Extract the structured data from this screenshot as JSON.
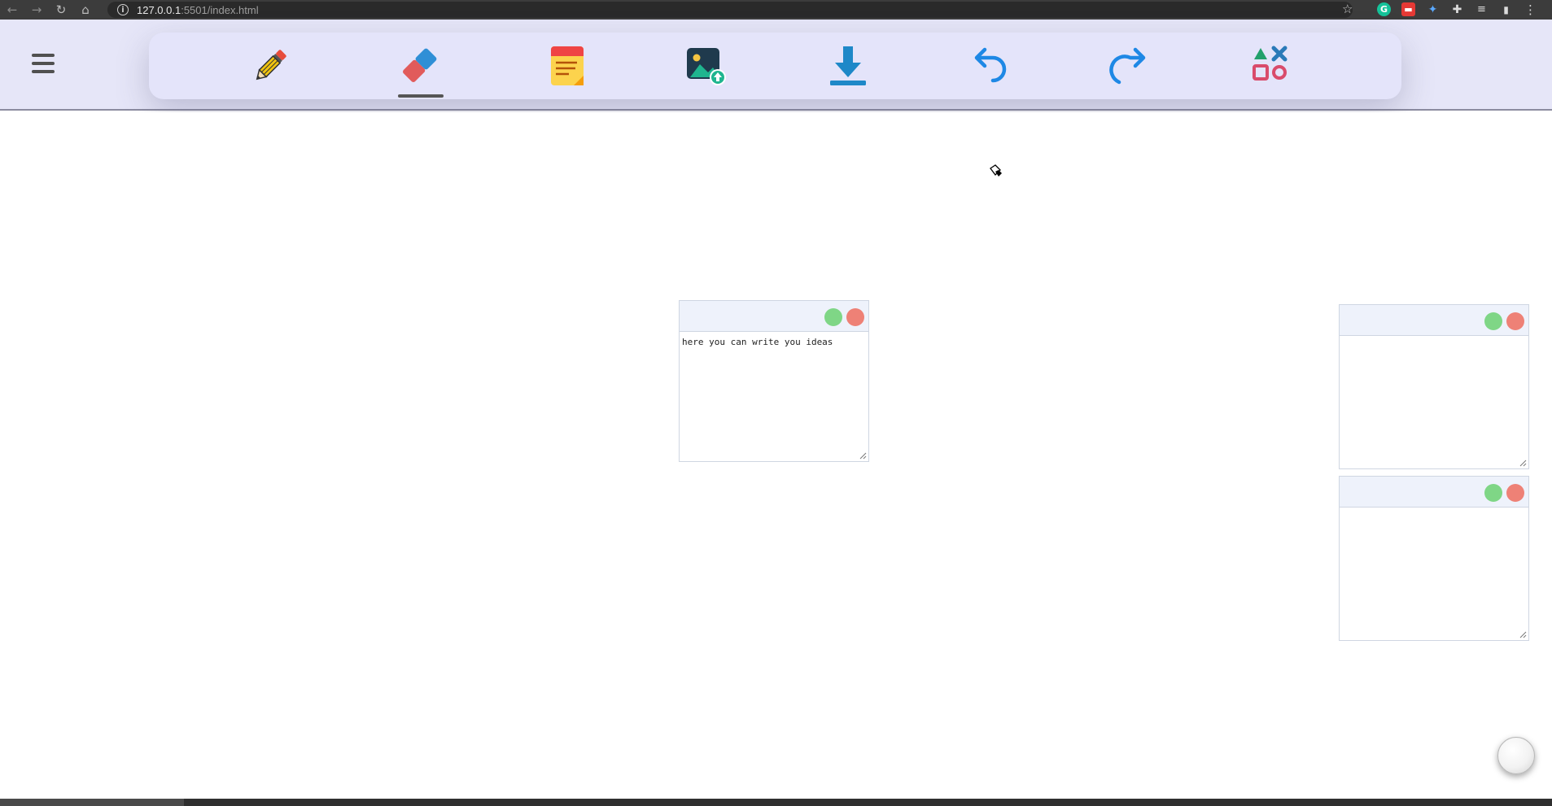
{
  "browser": {
    "url_host": "127.0.0.1",
    "url_rest": ":5501/index.html",
    "icons": [
      "back-arrow-icon",
      "forward-arrow-icon",
      "reload-icon",
      "home-icon",
      "info-icon",
      "star-icon",
      "grammarly-icon",
      "red-extension-icon",
      "blue-extension-icon",
      "puzzle-icon",
      "media-icon",
      "profile-icon",
      "menu-dots-icon"
    ],
    "grammarly_letter": "G"
  },
  "toolbar": {
    "tools": [
      {
        "name": "pencil",
        "icon": "pencil-icon"
      },
      {
        "name": "eraser",
        "icon": "eraser-icon",
        "active": true
      },
      {
        "name": "sticky-note",
        "icon": "sticky-note-icon"
      },
      {
        "name": "upload-image",
        "icon": "image-upload-icon"
      },
      {
        "name": "download",
        "icon": "download-icon"
      },
      {
        "name": "undo",
        "icon": "undo-icon"
      },
      {
        "name": "redo",
        "icon": "redo-icon"
      },
      {
        "name": "shapes",
        "icon": "shapes-icon"
      }
    ]
  },
  "notes": [
    {
      "text": "here you can write you ideas"
    },
    {
      "text": ""
    },
    {
      "text": ""
    }
  ],
  "colors": {
    "header_bg": "#e6e6f8",
    "toolbar_bg": "#e4e4fa",
    "note_header_bg": "#eef2fb",
    "dot_green": "#7fd686",
    "dot_red": "#ee8176",
    "accent_blue": "#1e88e5"
  }
}
